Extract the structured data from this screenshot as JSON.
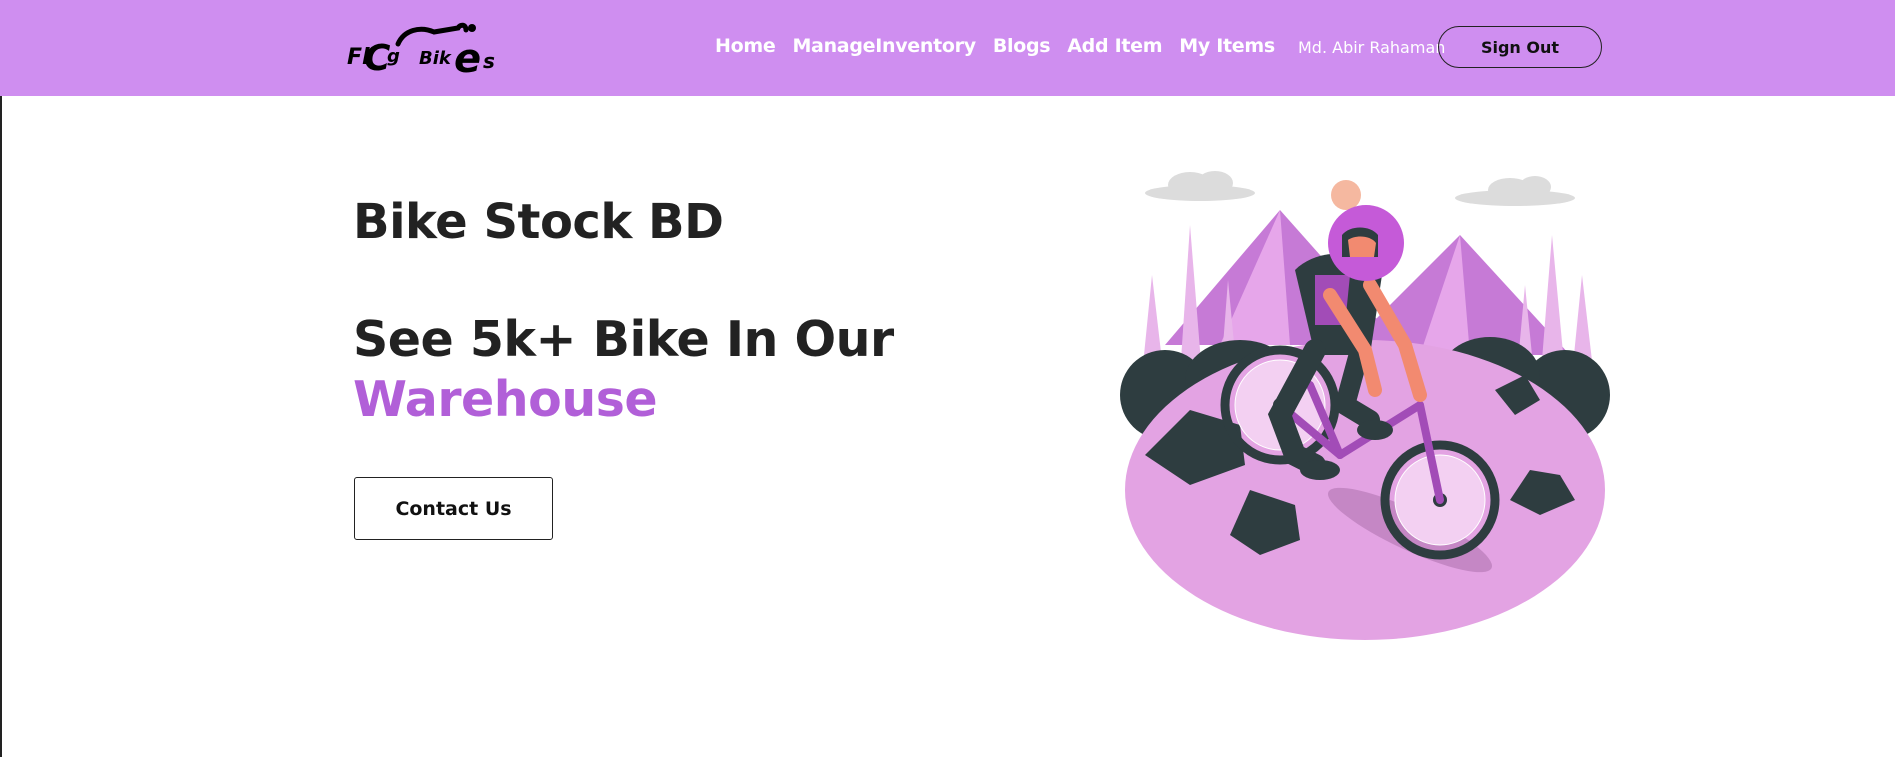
{
  "navbar": {
    "brand": "FlagBikes",
    "links": [
      "Home",
      "ManageInventory",
      "Blogs",
      "Add Item",
      "My Items"
    ],
    "user_name": "Md. Abir Rahaman",
    "sign_out_label": "Sign Out",
    "background": "#cf8ef0"
  },
  "hero": {
    "title": "Bike Stock BD",
    "subtitle_line1": "See 5k+ Bike In Our",
    "subtitle_accent": "Warehouse",
    "accent_color": "#b15fd8",
    "cta_label": "Contact Us"
  },
  "illustration": {
    "name": "mountain-biker-illustration"
  }
}
